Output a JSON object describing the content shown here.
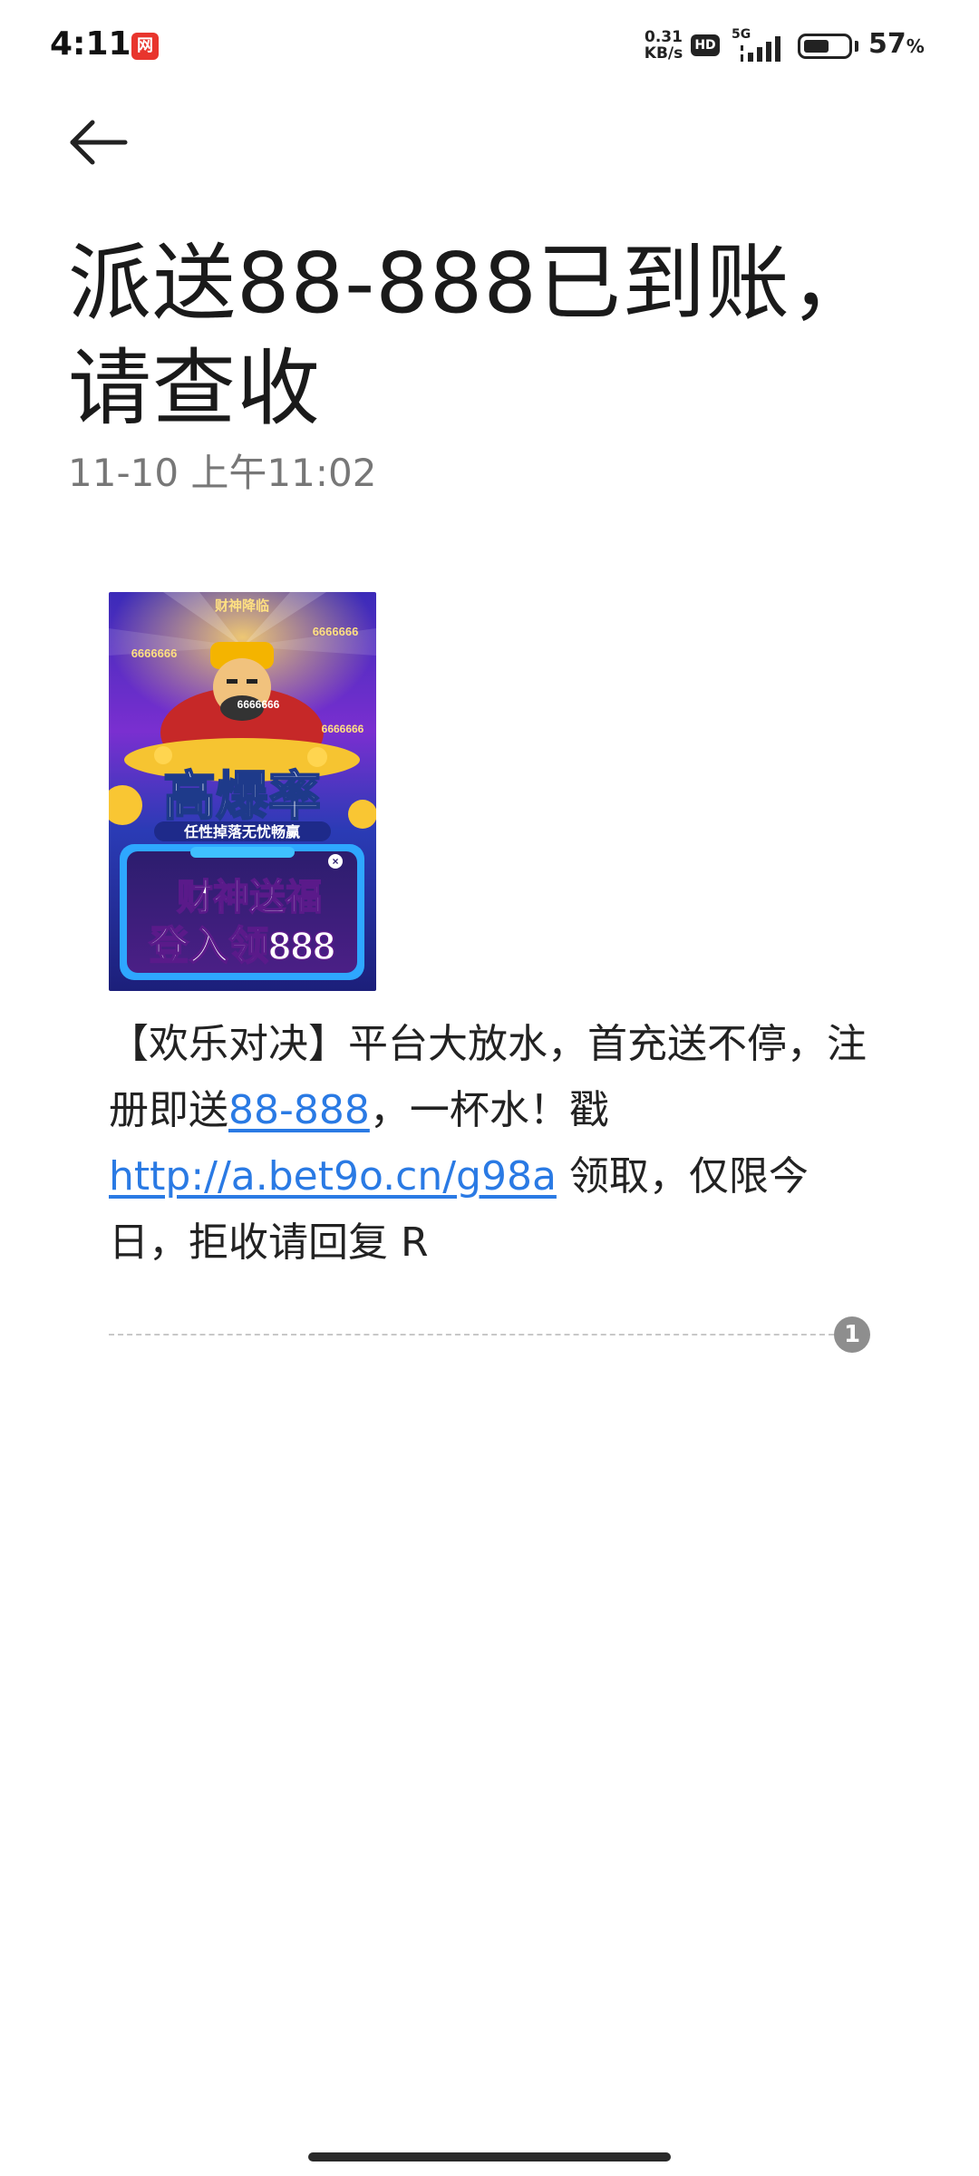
{
  "status_bar": {
    "time": "4:11",
    "notification_app": "网",
    "net_speed_value": "0.31",
    "net_speed_unit": "KB/s",
    "hd_label": "HD",
    "signal_label": "5G",
    "battery_percent": "57",
    "battery_percent_sign": "%",
    "battery_level": 0.57
  },
  "header": {
    "back_icon": "arrow-left-icon",
    "title": "派送88-888已到账，请查收",
    "date": "11-10 上午11:02"
  },
  "message": {
    "image": {
      "top_banner": "财神降临",
      "left_value": "6666666",
      "right_value": "6666666",
      "center_value": "6666666",
      "bottom_right_value": "6666666",
      "headline": "高爆率",
      "subline": "任性掉落无忧畅赢",
      "box_line1": "财神送福",
      "box_line2": "登入领888",
      "close_glyph": "×"
    },
    "body_part1": "【欢乐对决】平台大放水，首充送不停，注册即送",
    "link_amount": "88-888",
    "body_part2": "，一杯水！戳 ",
    "link_url": "http://a.bet9o.cn/g98a",
    "body_part3": " 领取，仅限今日，拒收请回复 R",
    "sim_number": "1"
  },
  "colors": {
    "link": "#2a7ae4",
    "title_text": "#1a1a1a",
    "meta_text": "#777777",
    "badge_bg": "#8e8e8e"
  }
}
